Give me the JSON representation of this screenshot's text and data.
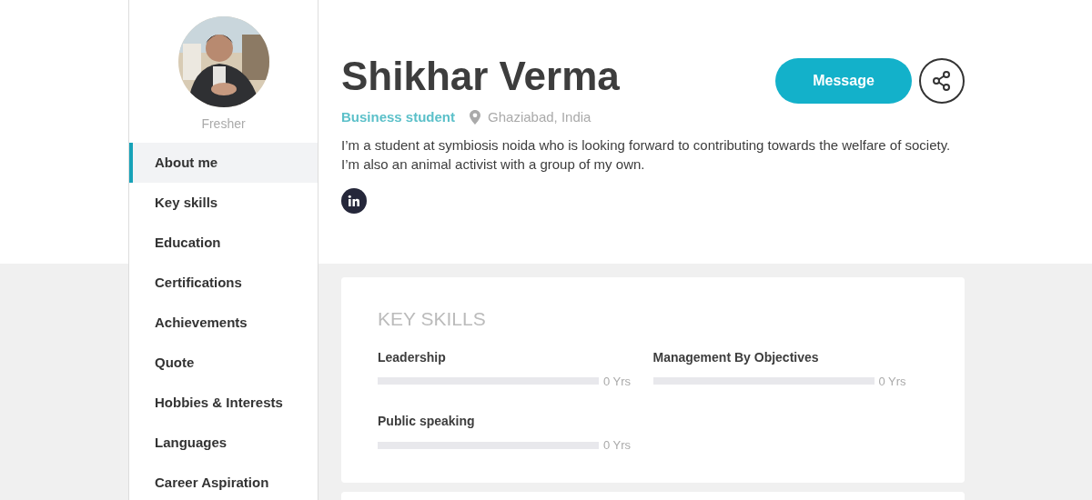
{
  "profile": {
    "status": "Fresher",
    "name": "Shikhar Verma",
    "role": "Business student",
    "location": "Ghaziabad, India",
    "bio": "I’m a student at symbiosis noida who is looking forward to contributing towards the welfare of society. I’m also an animal activist with a group of my own.",
    "message_button": "Message"
  },
  "sidebar": {
    "items": [
      {
        "label": "About me",
        "selected": true
      },
      {
        "label": "Key skills",
        "selected": false
      },
      {
        "label": "Education",
        "selected": false
      },
      {
        "label": "Certifications",
        "selected": false
      },
      {
        "label": "Achievements",
        "selected": false
      },
      {
        "label": "Quote",
        "selected": false
      },
      {
        "label": "Hobbies & Interests",
        "selected": false
      },
      {
        "label": "Languages",
        "selected": false
      },
      {
        "label": "Career Aspiration",
        "selected": false
      }
    ]
  },
  "key_skills": {
    "title": "KEY SKILLS",
    "skills": [
      {
        "name": "Leadership",
        "level": 0,
        "reading": "0 Yrs"
      },
      {
        "name": "Management By Objectives",
        "level": 0,
        "reading": "0 Yrs"
      },
      {
        "name": "Public speaking",
        "level": 0,
        "reading": "0 Yrs"
      }
    ]
  }
}
